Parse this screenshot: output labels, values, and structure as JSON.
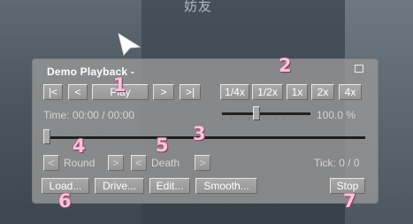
{
  "background": {
    "text": "妨友"
  },
  "cursor": {
    "icon": "arrow-pointer-icon"
  },
  "panel": {
    "title": "Demo Playback -",
    "controls": {
      "first": "|<",
      "prev": "<",
      "play": "Play",
      "next": ">",
      "last": ">|"
    },
    "speeds": [
      "1/4x",
      "1/2x",
      "1x",
      "2x",
      "4x"
    ],
    "time_text": "Time: 00:00 / 00:00",
    "speed_percent": "100.0 %",
    "speed_slider_fraction": 0.375,
    "timeline_fraction": 0.0,
    "round": {
      "prev": "<",
      "label": "Round",
      "next": ">"
    },
    "death": {
      "prev": "<",
      "label": "Death",
      "next": ">"
    },
    "tick_text": "Tick: 0 / 0",
    "actions": [
      "Load...",
      "Drive...",
      "Edit...",
      "Smooth..."
    ],
    "stop": "Stop"
  },
  "annotations": [
    "1",
    "2",
    "3",
    "4",
    "5",
    "6",
    "7"
  ],
  "colors": {
    "annotation": "#f7c3d9",
    "panel": "#969696"
  }
}
